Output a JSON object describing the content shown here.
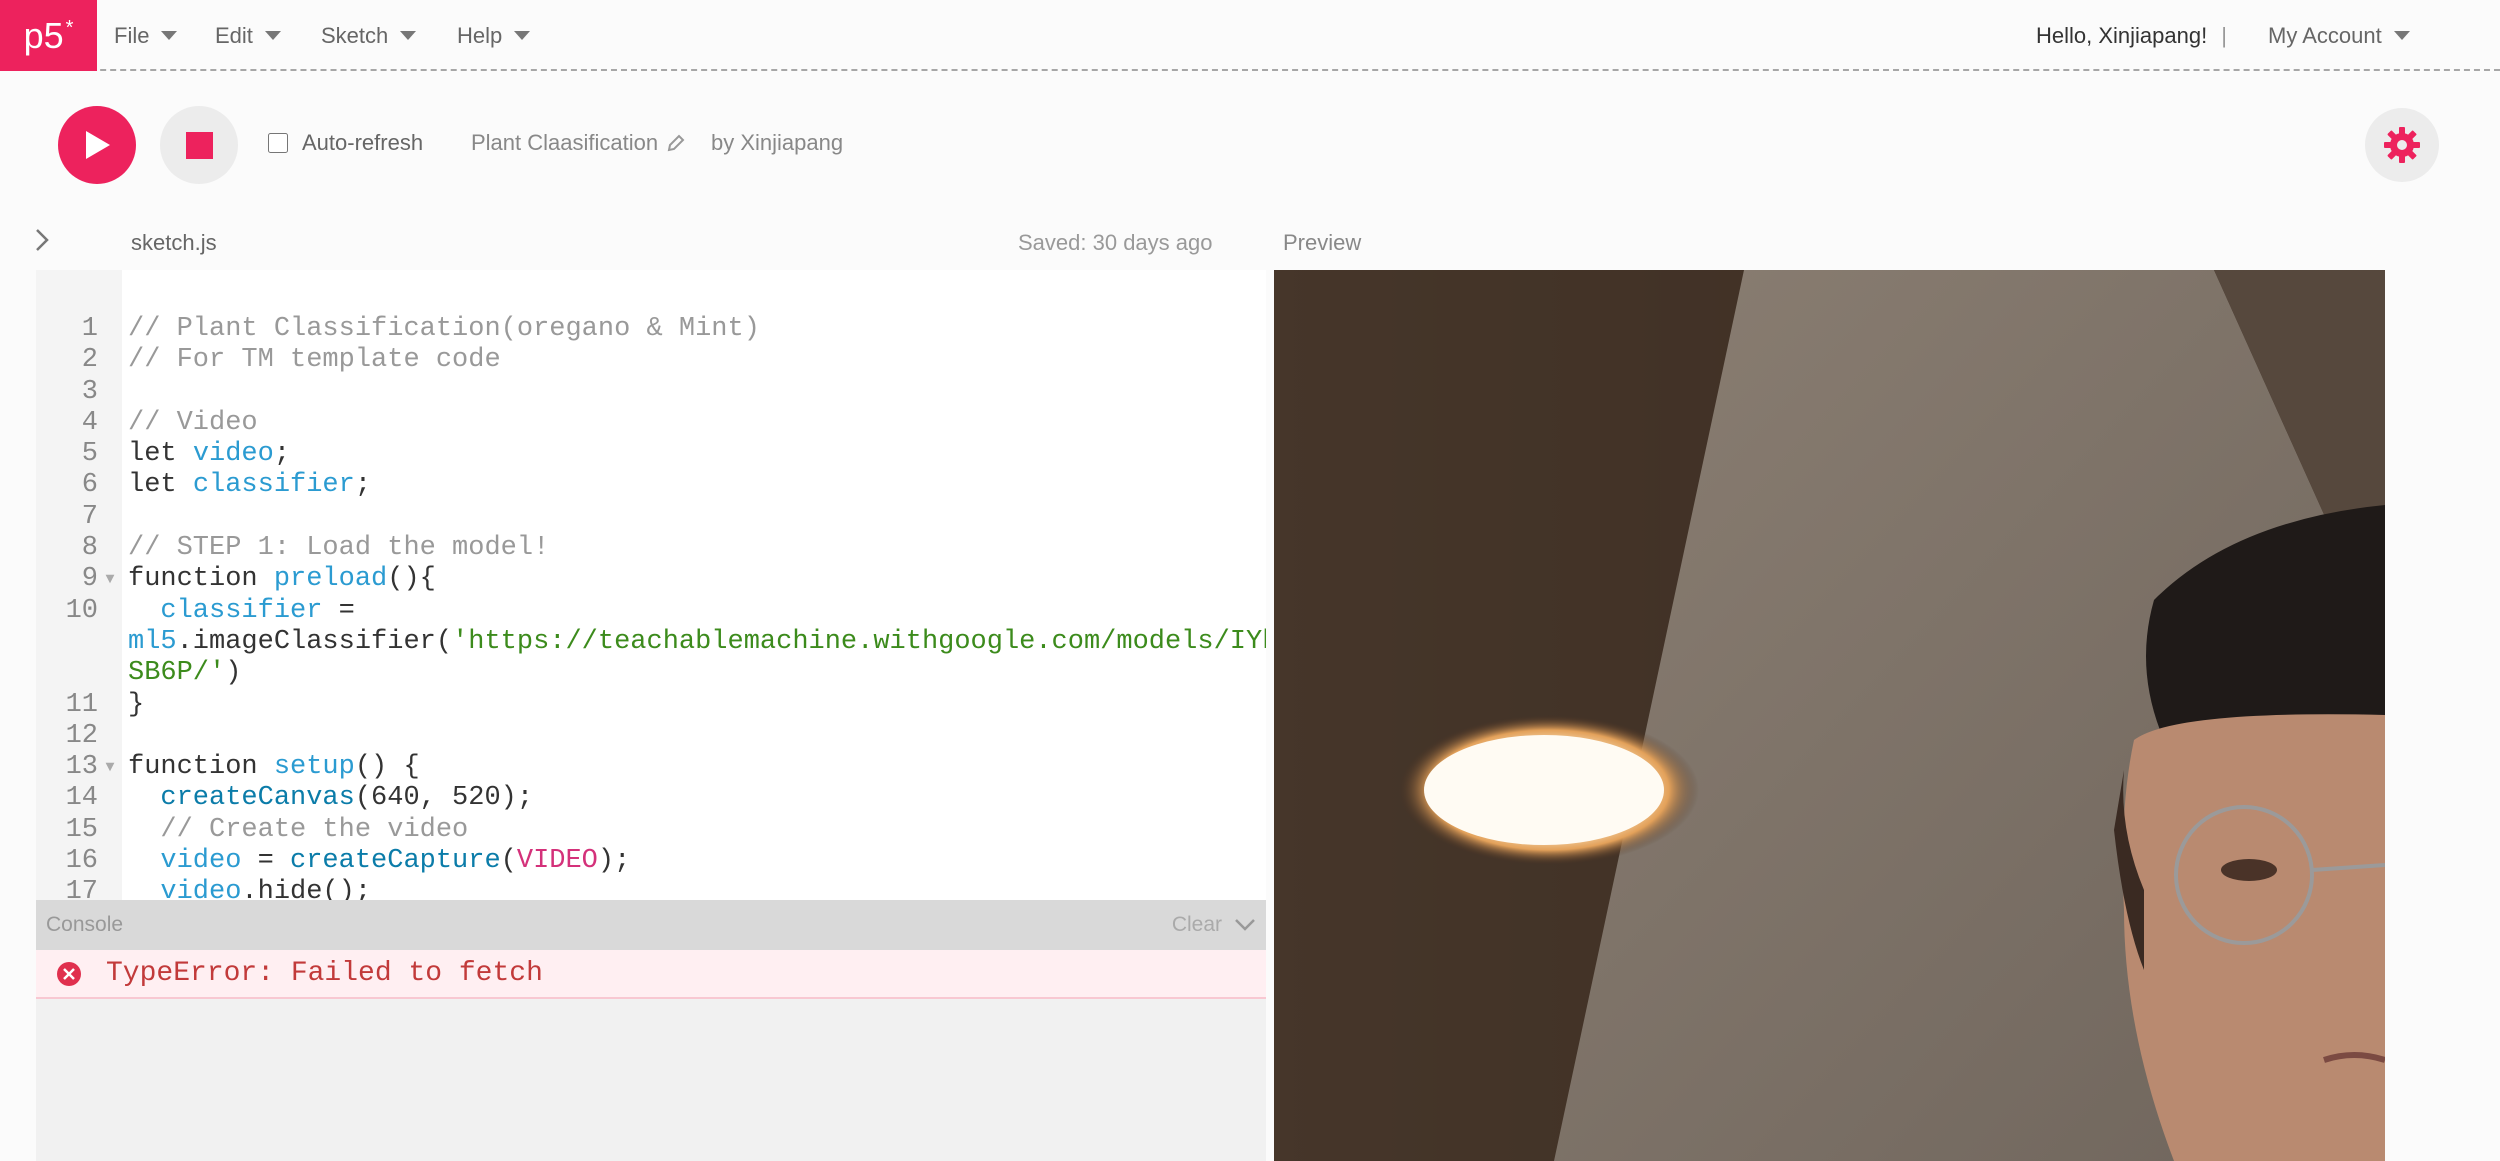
{
  "nav": {
    "logo_text": "p5",
    "logo_star": "*",
    "menus": [
      "File",
      "Edit",
      "Sketch",
      "Help"
    ],
    "greeting": "Hello, Xinjiapang!",
    "separator": "|",
    "account": "My Account"
  },
  "toolbar": {
    "auto_refresh_label": "Auto-refresh",
    "project_name": "Plant Claasification",
    "by_line": "by Xinjiapang"
  },
  "editor": {
    "file_name": "sketch.js",
    "saved_text": "Saved: 30 days ago",
    "preview_label": "Preview",
    "line_numbers": [
      "1",
      "2",
      "3",
      "4",
      "5",
      "6",
      "7",
      "8",
      "9",
      "10",
      "",
      "",
      "11",
      "12",
      "13",
      "14",
      "15",
      "16",
      "17"
    ]
  },
  "code": {
    "l1": "// Plant Classification(oregano & Mint)",
    "l2": "// For TM template code",
    "l4": "// Video",
    "l5_kw": "let ",
    "l5_var": "video",
    "l5_end": ";",
    "l6_kw": "let ",
    "l6_var": "classifier",
    "l6_end": ";",
    "l8": "// STEP 1: Load the model!",
    "l9_kw": "function ",
    "l9_fn": "preload",
    "l9_end": "(){",
    "l10_var": "  classifier",
    "l10_end": " =",
    "l10b_var": "ml5",
    "l10b_mid": ".imageClassifier(",
    "l10b_str": "'https://teachablemachine.withgoogle.com/models/IYhw",
    "l10c_str": "SB6P/'",
    "l10c_end": ")",
    "l11": "}",
    "l13_kw": "function ",
    "l13_fn": "setup",
    "l13_end": "() {",
    "l14_fn": "  createCanvas",
    "l14_end": "(640, 520);",
    "l15": "  // Create the video",
    "l16_var": "  video",
    "l16_mid": " = ",
    "l16_fn": "createCapture",
    "l16_p": "(",
    "l16_const": "VIDEO",
    "l16_end": ");",
    "l17_var": "  video",
    "l17_end": ".hide();"
  },
  "console": {
    "title": "Console",
    "clear": "Clear",
    "error": "TypeError: Failed to fetch"
  },
  "colors": {
    "accent": "#ed225d",
    "error_text": "#c23a3a"
  }
}
